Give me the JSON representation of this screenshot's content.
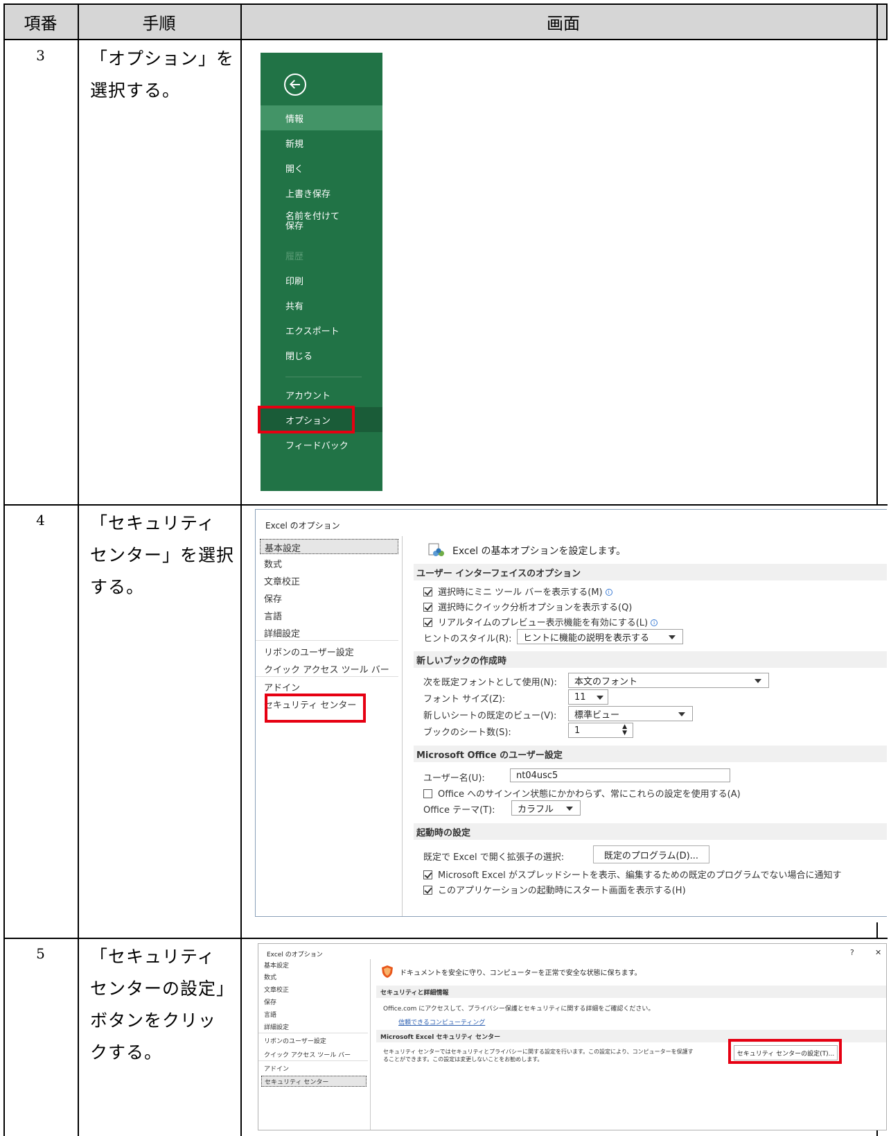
{
  "table": {
    "headers": {
      "col_no": "項番",
      "col_step": "手順",
      "col_screen": "画面"
    },
    "rows": [
      {
        "no": "3",
        "step_lines": [
          "「オプション」を",
          "選択する。"
        ]
      },
      {
        "no": "4",
        "step_lines": [
          "「セキュリティ",
          "センター」を選択",
          "する。"
        ]
      },
      {
        "no": "5",
        "step_lines": [
          "「セキュリティ",
          "センターの設定」",
          "ボタンをクリッ",
          "クする。"
        ]
      }
    ]
  },
  "backstage": {
    "items": [
      "情報",
      "新規",
      "開く",
      "上書き保存",
      "名前を付けて",
      "保存",
      "履歴",
      "印刷",
      "共有",
      "エクスポート",
      "閉じる",
      "アカウント",
      "オプション",
      "フィードバック"
    ]
  },
  "options_dialog": {
    "title": "Excel のオプション",
    "nav": [
      "基本設定",
      "数式",
      "文章校正",
      "保存",
      "言語",
      "詳細設定",
      "リボンのユーザー設定",
      "クイック アクセス ツール バー",
      "アドイン",
      "セキュリティ センター"
    ],
    "heading": "Excel の基本オプションを設定します。",
    "sections": {
      "ui": "ユーザー インターフェイスのオプション",
      "new_book": "新しいブックの作成時",
      "user": "Microsoft Office のユーザー設定",
      "startup": "起動時の設定"
    },
    "ui_options": {
      "mini_toolbar": "選択時にミニ ツール バーを表示する(M)",
      "quick_analysis": "選択時にクイック分析オプションを表示する(Q)",
      "live_preview": "リアルタイムのプレビュー表示機能を有効にする(L)",
      "tip_style_label": "ヒントのスタイル(R):",
      "tip_style_value": "ヒントに機能の説明を表示する"
    },
    "new_book_options": {
      "font_label": "次を既定フォントとして使用(N):",
      "font_value": "本文のフォント",
      "size_label": "フォント サイズ(Z):",
      "size_value": "11",
      "view_label": "新しいシートの既定のビュー(V):",
      "view_value": "標準ビュー",
      "sheets_label": "ブックのシート数(S):",
      "sheets_value": "1"
    },
    "user_options": {
      "username_label": "ユーザー名(U):",
      "username_value": "nt04usc5",
      "always_use": "Office へのサインイン状態にかかわらず、常にこれらの設定を使用する(A)",
      "theme_label": "Office テーマ(T):",
      "theme_value": "カラフル"
    },
    "startup_options": {
      "ext_label": "既定で Excel で開く拡張子の選択:",
      "ext_button": "既定のプログラム(D)...",
      "notify": "Microsoft Excel がスプレッドシートを表示、編集するための既定のプログラムでない場合に通知す",
      "start_screen": "このアプリケーションの起動時にスタート画面を表示する(H)"
    }
  },
  "trust_dialog": {
    "title": "Excel のオプション",
    "help": "?",
    "close": "✕",
    "nav": [
      "基本設定",
      "数式",
      "文章校正",
      "保存",
      "言語",
      "詳細設定",
      "リボンのユーザー設定",
      "クイック アクセス ツール バー",
      "アドイン",
      "セキュリティ センター"
    ],
    "heading": "ドキュメントを安全に守り、コンピューターを正常で安全な状態に保ちます。",
    "section1": "セキュリティと詳細情報",
    "section1_text": "Office.com にアクセスして、プライバシー保護とセキュリティに関する詳細をご確認ください。",
    "link": "信頼できるコンピューティング",
    "section2": "Microsoft Excel セキュリティ センター",
    "section2_text1": "セキュリティ センターではセキュリティとプライバシーに関する設定を行います。この設定により、コンピューターを保護す",
    "section2_text2": "ることができます。この設定は変更しないことをお勧めします。",
    "button": "セキュリティ センターの設定(T)..."
  },
  "colors": {
    "excel_green": "#217346",
    "highlight_red": "#e60012",
    "header_gray": "#d6d6d6"
  }
}
